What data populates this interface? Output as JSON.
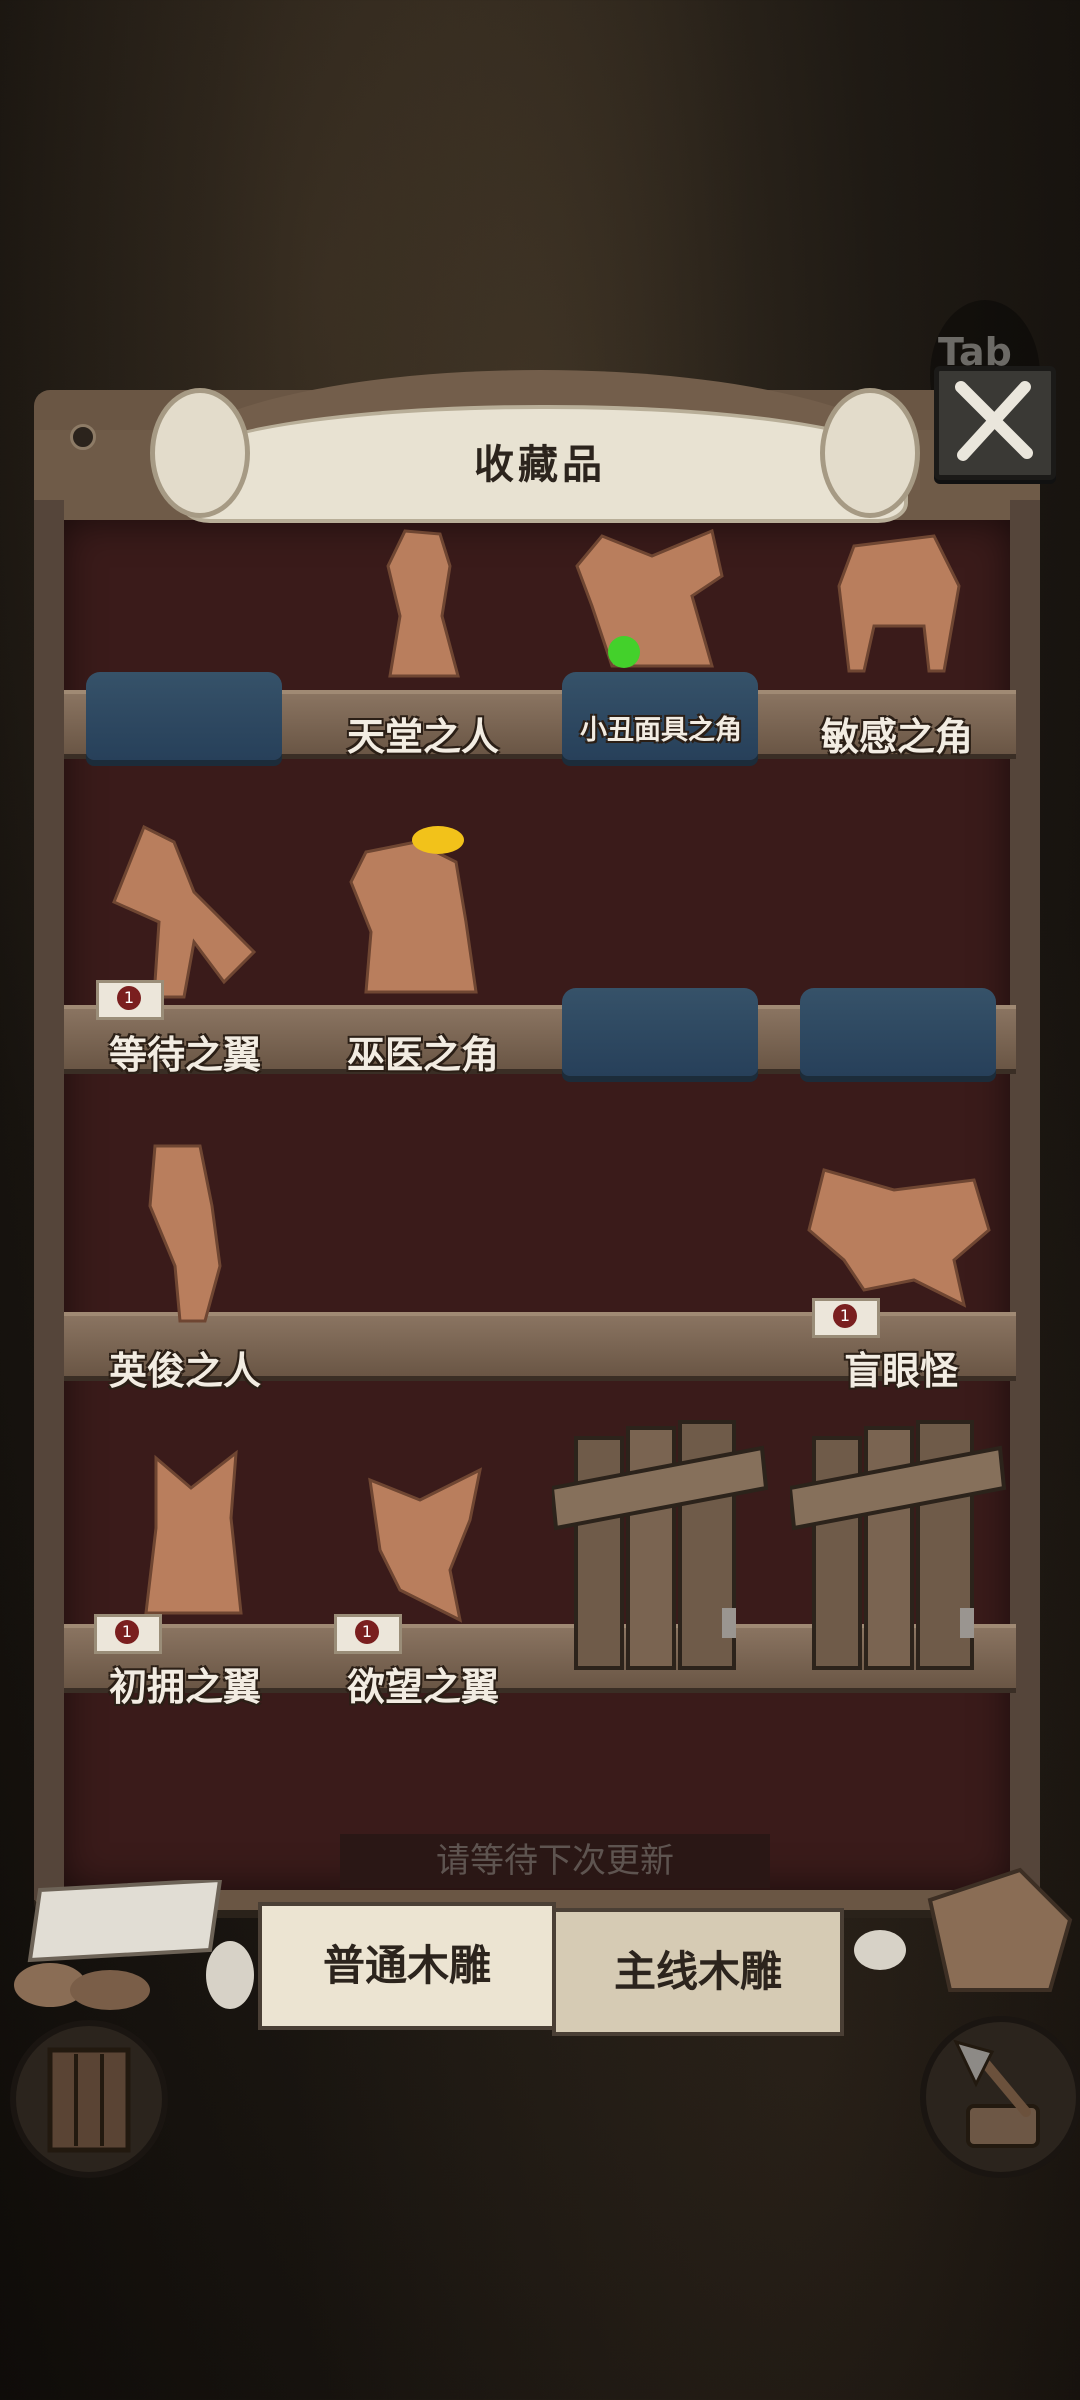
{
  "tab_key": "Tab",
  "title": "收藏品",
  "shelves": [
    {
      "slots": [
        {
          "label": "",
          "state": "empty-cloth"
        },
        {
          "label": "天堂之人",
          "state": "figure"
        },
        {
          "label": "小丑面具之角",
          "state": "figure"
        },
        {
          "label": "敏感之角",
          "state": "figure"
        }
      ]
    },
    {
      "slots": [
        {
          "label": "等待之翼",
          "state": "figure",
          "badge": "1"
        },
        {
          "label": "巫医之角",
          "state": "figure"
        },
        {
          "label": "",
          "state": "empty-cloth"
        },
        {
          "label": "",
          "state": "empty-cloth"
        }
      ]
    },
    {
      "slots": [
        {
          "label": "英俊之人",
          "state": "figure"
        },
        {
          "label": "",
          "state": "empty"
        },
        {
          "label": "",
          "state": "empty"
        },
        {
          "label": "盲眼怪",
          "state": "figure",
          "badge": "1"
        }
      ]
    },
    {
      "slots": [
        {
          "label": "初拥之翼",
          "state": "figure",
          "badge": "1"
        },
        {
          "label": "欲望之翼",
          "state": "figure",
          "badge": "1"
        },
        {
          "label": "",
          "state": "locked"
        },
        {
          "label": "",
          "state": "locked"
        }
      ]
    }
  ],
  "notice": "请等待下次更新",
  "tabs": {
    "normal": "普通木雕",
    "main": "主线木雕"
  },
  "colors": {
    "shelf_back": "#3a1b1a",
    "wood": "#6a5644",
    "cloth": "#365269",
    "figure": "#b97e5d"
  }
}
